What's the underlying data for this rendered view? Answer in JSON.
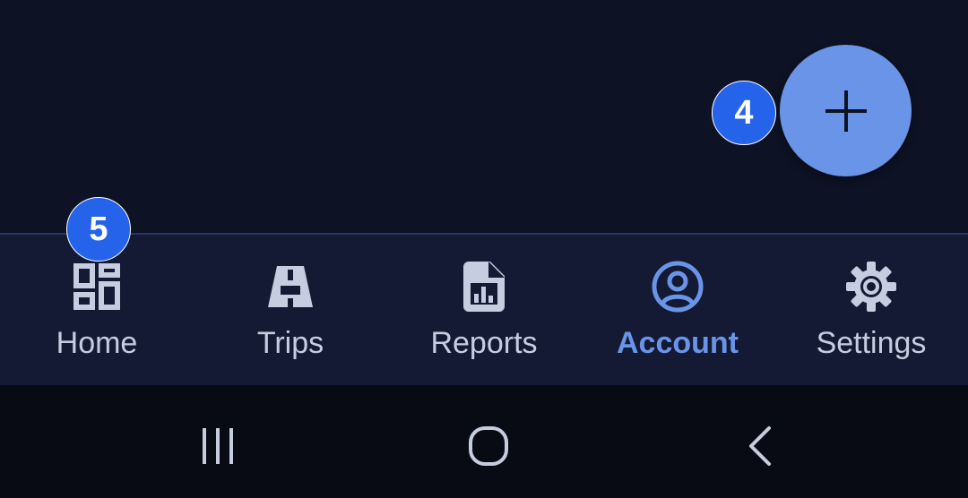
{
  "fab": {
    "icon": "plus-icon",
    "color": "#6a94e8"
  },
  "badges": {
    "fab_badge": "4",
    "home_badge": "5"
  },
  "bottom_nav": {
    "items": [
      {
        "label": "Home",
        "icon": "dashboard-icon",
        "active": false
      },
      {
        "label": "Trips",
        "icon": "road-icon",
        "active": false
      },
      {
        "label": "Reports",
        "icon": "report-icon",
        "active": false
      },
      {
        "label": "Account",
        "icon": "account-circle-icon",
        "active": true
      },
      {
        "label": "Settings",
        "icon": "gear-icon",
        "active": false
      }
    ]
  },
  "system_nav": {
    "recents_icon": "recents-icon",
    "home_icon": "home-circle-icon",
    "back_icon": "back-icon"
  },
  "colors": {
    "background": "#0d1224",
    "nav_background": "#141a33",
    "accent": "#6a94e8",
    "badge": "#2563eb",
    "inactive": "#c6cde0"
  }
}
